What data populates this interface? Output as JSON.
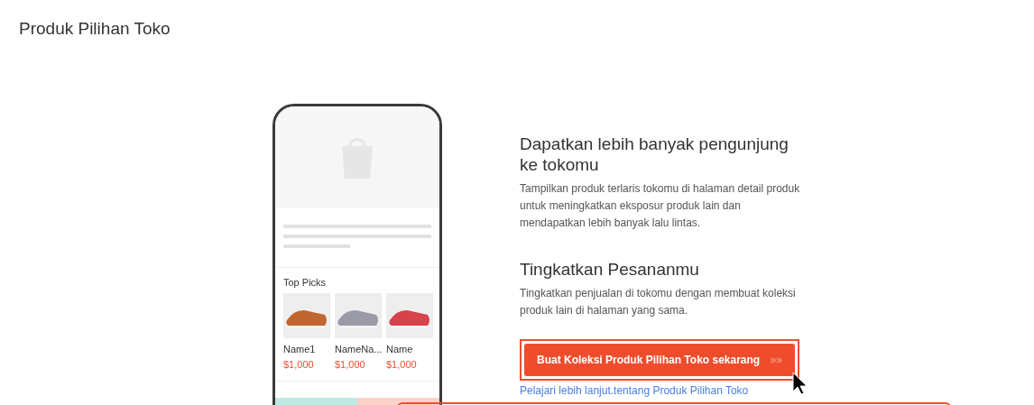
{
  "page_title": "Produk Pilihan Toko",
  "phone": {
    "section_title": "Top Picks",
    "products": [
      {
        "name": "Name1",
        "price": "$1,000",
        "color": "#c0662e"
      },
      {
        "name": "NameNa...",
        "price": "$1,000",
        "color": "#9a9aa8"
      },
      {
        "name": "Name",
        "price": "$1,000",
        "color": "#d8424a"
      }
    ]
  },
  "benefits": [
    {
      "title": "Dapatkan lebih banyak pengunjung ke tokomu",
      "text": "Tampilkan produk terlaris tokomu di halaman detail produk untuk meningkatkan eksposur produk lain dan mendapatkan lebih banyak lalu lintas."
    },
    {
      "title": "Tingkatkan Pesananmu",
      "text": "Tingkatkan penjualan di tokomu dengan membuat koleksi produk lain di halaman yang sama."
    }
  ],
  "cta_button": {
    "label": "Buat Koleksi Produk Pilihan Toko sekarang",
    "arrows": "»»"
  },
  "learn_more_link": "Pelajari lebih lanjut.tentang Produk Pilihan Toko"
}
